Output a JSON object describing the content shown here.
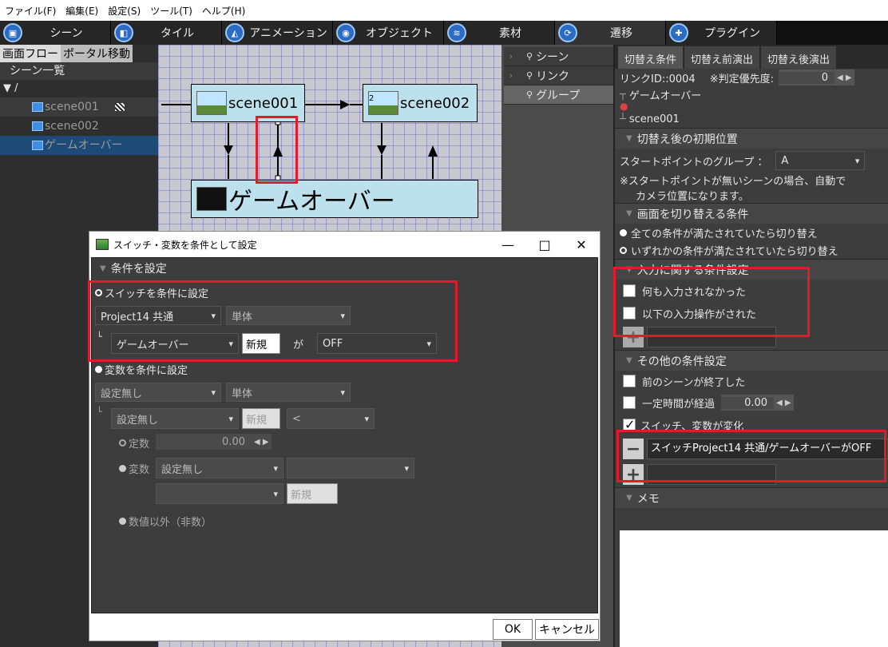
{
  "menubar": [
    "ファイル(F)",
    "編集(E)",
    "設定(S)",
    "ツール(T)",
    "ヘルプ(H)"
  ],
  "toolbar": [
    {
      "label": "シーン",
      "icon": "scene-icon"
    },
    {
      "label": "タイル",
      "icon": "tile-icon"
    },
    {
      "label": "アニメーション",
      "icon": "animation-icon"
    },
    {
      "label": "オブジェクト",
      "icon": "object-icon"
    },
    {
      "label": "素材",
      "icon": "material-icon"
    },
    {
      "label": "遷移",
      "icon": "transition-icon"
    },
    {
      "label": "プラグイン",
      "icon": "plugin-icon"
    }
  ],
  "left": {
    "tab_flow": "画面フロー",
    "tab_portal": "ポータル移動",
    "header": "シーン一覧",
    "root": "▼ /",
    "items": [
      "scene001",
      "scene002",
      "ゲームオーバー"
    ]
  },
  "flow": {
    "node1": "scene001",
    "node2": "scene002",
    "node3": "ゲームオーバー",
    "thumb_num": "2"
  },
  "overlay": [
    "シーン",
    "リンク",
    "グループ"
  ],
  "right": {
    "tabs": [
      "切替え条件",
      "切替え前演出",
      "切替え後演出"
    ],
    "link_id": "リンクID::0004",
    "priority_label": "※判定優先度:",
    "priority_value": "0",
    "from_scene": "ゲームオーバー",
    "to_scene": "scene001",
    "sec_initial": "切替え後の初期位置",
    "start_group_label": "スタートポイントのグループ ：",
    "start_group_value": "A",
    "note1": "※スタートポイントが無いシーンの場合、自動で",
    "note2": "カメラ位置になります。",
    "sec_switch": "画面を切り替える条件",
    "opt_all": "全ての条件が満たされていたら切り替え",
    "opt_any": "いずれかの条件が満たされていたら切り替え",
    "sec_input": "入力に関する条件設定",
    "cb_no_input": "何も入力されなかった",
    "cb_input_done": "以下の入力操作がされた",
    "sec_other": "その他の条件設定",
    "cb_prev_end": "前のシーンが終了した",
    "cb_time": "一定時間が経過",
    "time_value": "0.00",
    "cb_switch": "スイッチ、変数が変化",
    "switch_entry": "スイッチProject14 共通/ゲームオーバーがOFF",
    "sec_memo": "メモ"
  },
  "dialog": {
    "title": "スイッチ・変数を条件として設定",
    "sec_condition": "条件を設定",
    "radio_switch": "スイッチを条件に設定",
    "sw_group": "Project14 共通",
    "sw_mode": "単体",
    "sw_name": "ゲームオーバー",
    "new_label": "新規",
    "ga": "が",
    "sw_value": "OFF",
    "radio_var": "変数を条件に設定",
    "var_group": "設定無し",
    "var_mode": "単体",
    "var_name": "設定無し",
    "var_op": "<",
    "const_label": "定数",
    "const_value": "0.00",
    "var2_label": "変数",
    "var2_value": "設定無し",
    "non_num": "数値以外（非数）",
    "ok": "OK",
    "cancel": "キャンセル"
  }
}
